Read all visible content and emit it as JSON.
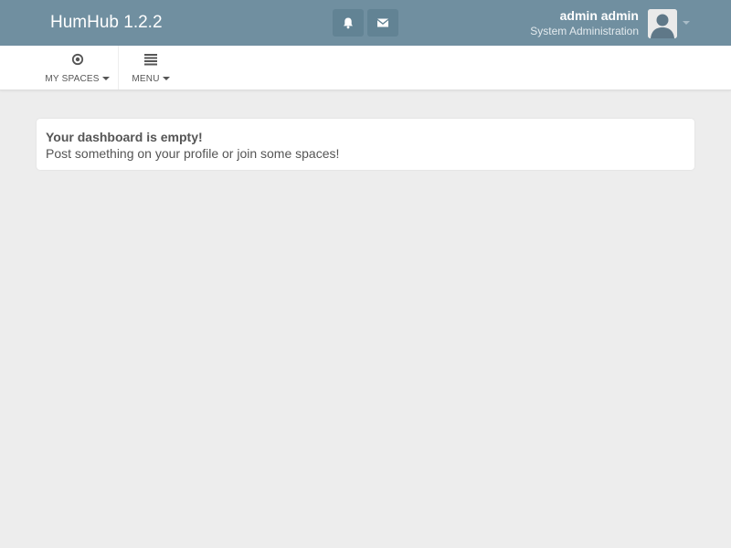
{
  "topbar": {
    "brand": "HumHub 1.2.2",
    "background": "#708fa0",
    "buttons": [
      {
        "icon": "bell-icon"
      },
      {
        "icon": "envelope-icon"
      }
    ],
    "user": {
      "name": "admin admin",
      "role": "System Administration",
      "avatar_icon": "user-silhouette-icon"
    }
  },
  "subnav": {
    "items": [
      {
        "label": "MY SPACES",
        "icon": "dot-circle-icon"
      },
      {
        "label": "MENU",
        "icon": "list-lines-icon"
      }
    ]
  },
  "dashboard": {
    "title": "Your dashboard is empty!",
    "message": "Post something on your profile or join some spaces!"
  }
}
